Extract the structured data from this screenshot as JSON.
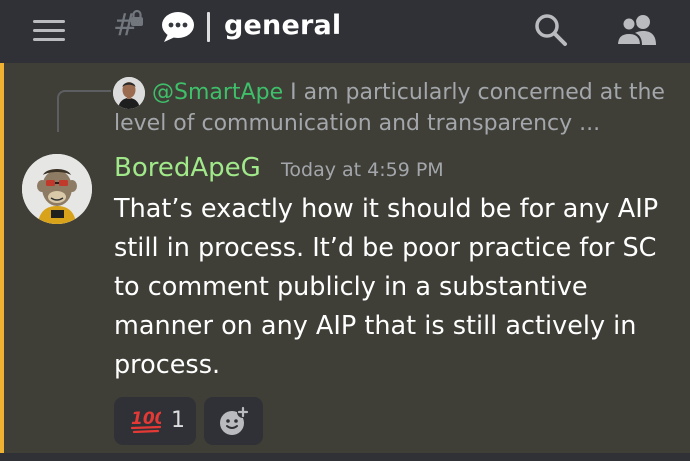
{
  "channel": {
    "name": "general",
    "hash_glyph": "#"
  },
  "icons": {
    "menu": "hamburger-icon",
    "channel_type": "hash-lock-icon",
    "channel_emoji": "speech-bubble-icon",
    "search": "search-icon",
    "members": "members-icon",
    "reaction": "hundred-points-emoji",
    "add_reaction": "add-reaction-icon"
  },
  "colors": {
    "accent_highlight": "#f0b232",
    "mention": "#3fbf6a",
    "author": "#a0e889",
    "background": "#36393f",
    "header": "#2f3136"
  },
  "reply": {
    "mention": "@SmartApe",
    "text": "I am particularly concerned at the level of communication and transparency ..."
  },
  "message": {
    "author": "BoredApeG",
    "timestamp": "Today at 4:59 PM",
    "content": "That’s exactly how it should be for any AIP still in process. It’d be poor practice for SC to comment publicly in a substantive manner on any AIP that is still actively in process."
  },
  "reactions": [
    {
      "emoji": "💯",
      "count": "1"
    }
  ]
}
